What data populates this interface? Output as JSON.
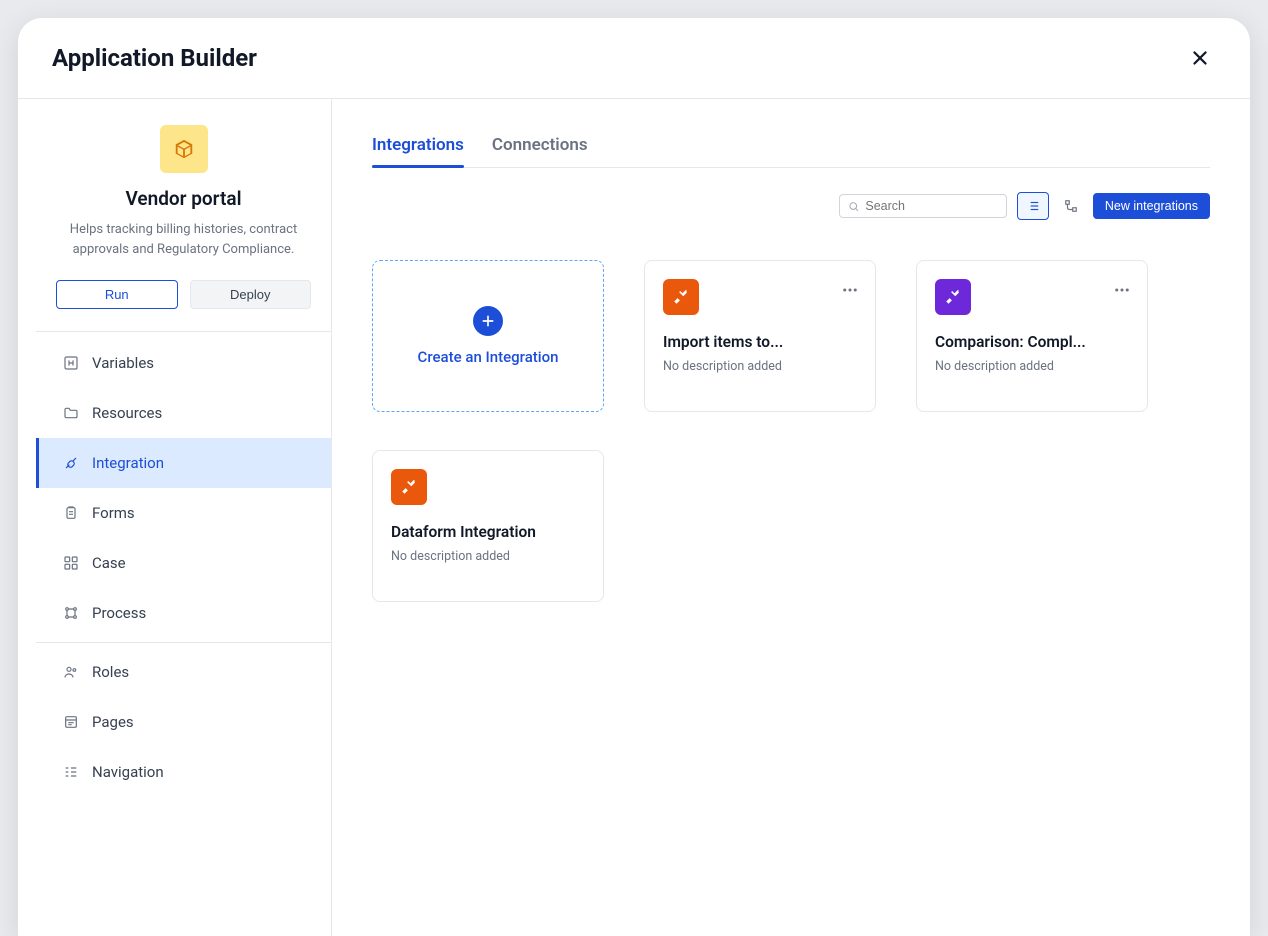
{
  "header": {
    "title": "Application Builder"
  },
  "app": {
    "name": "Vendor portal",
    "description": "Helps tracking billing histories, contract approvals and Regulatory Compliance.",
    "run_label": "Run",
    "deploy_label": "Deploy"
  },
  "nav": {
    "items": [
      {
        "icon": "variables-icon",
        "label": "Variables"
      },
      {
        "icon": "folder-icon",
        "label": "Resources"
      },
      {
        "icon": "plug-icon",
        "label": "Integration",
        "selected": true
      },
      {
        "icon": "clipboard-icon",
        "label": "Forms"
      },
      {
        "icon": "grid-icon",
        "label": "Case"
      },
      {
        "icon": "process-icon",
        "label": "Process"
      }
    ],
    "items2": [
      {
        "icon": "roles-icon",
        "label": "Roles"
      },
      {
        "icon": "pages-icon",
        "label": "Pages"
      },
      {
        "icon": "navigation-icon",
        "label": "Navigation"
      }
    ]
  },
  "tabs": {
    "integrations": "Integrations",
    "connections": "Connections"
  },
  "toolbar": {
    "search_placeholder": "Search",
    "new_button": "New integrations"
  },
  "create_card": {
    "label": "Create an Integration"
  },
  "cards": [
    {
      "iconClass": "orange",
      "title": "Import items to...",
      "desc": "No description added"
    },
    {
      "iconClass": "purple",
      "title": "Comparison: Compl...",
      "desc": "No description added"
    },
    {
      "iconClass": "orange",
      "title": "Dataform Integration",
      "desc": "No description added"
    }
  ]
}
